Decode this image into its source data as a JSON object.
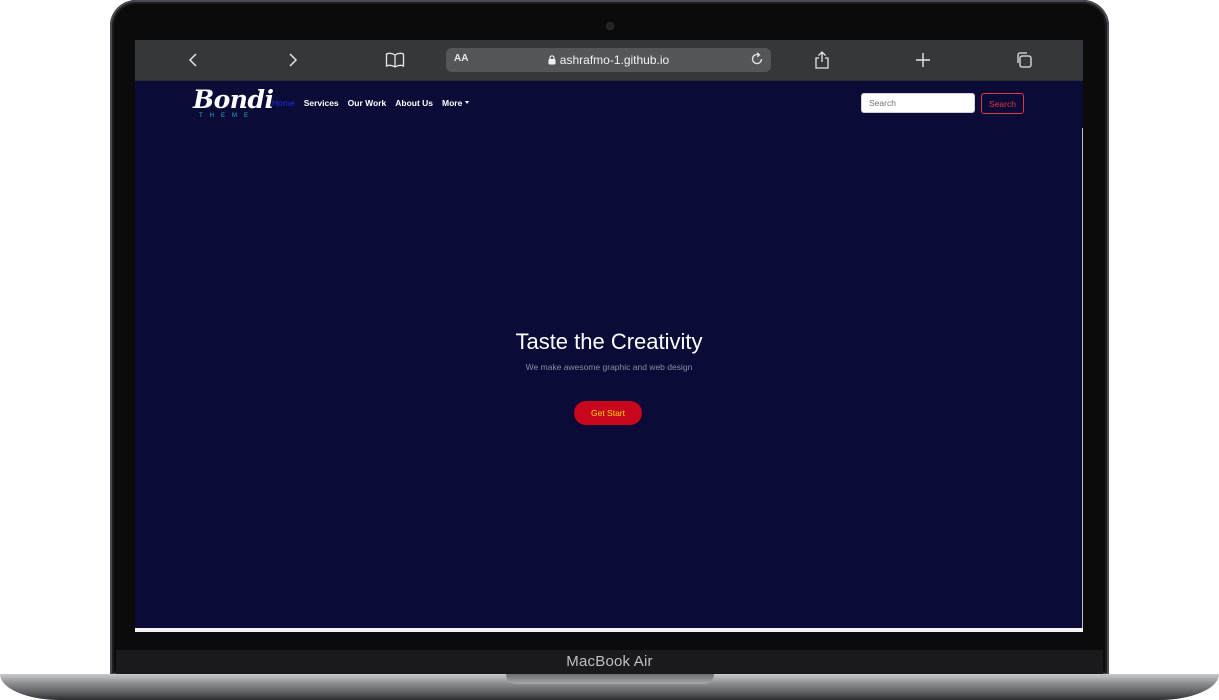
{
  "device": {
    "label": "MacBook Air"
  },
  "browser": {
    "address": {
      "text_size_label": "AA",
      "url": "ashrafmo-1.github.io"
    },
    "icons": {
      "back": "chevron-left-icon",
      "forward": "chevron-right-icon",
      "bookmarks": "book-icon",
      "lock": "lock-icon",
      "reload": "reload-icon",
      "share": "share-icon",
      "new_tab": "plus-icon",
      "tabs": "tabs-icon"
    }
  },
  "site": {
    "logo": {
      "word": "Bondi",
      "sub": "THEME"
    },
    "nav": {
      "items": [
        {
          "label": "Home",
          "active": true
        },
        {
          "label": "Services"
        },
        {
          "label": "Our Work"
        },
        {
          "label": "About Us"
        },
        {
          "label": "More"
        }
      ]
    },
    "search": {
      "placeholder": "Search",
      "button_label": "Search"
    },
    "hero": {
      "title": "Taste the Creativity",
      "subtitle": "We make awesome graphic and web design",
      "cta_label": "Get Start"
    }
  },
  "colors": {
    "page_bg": "#0a0b36",
    "accent": "#c8071d",
    "cta_text": "#ffd400",
    "nav_active": "#1f2ae0"
  }
}
